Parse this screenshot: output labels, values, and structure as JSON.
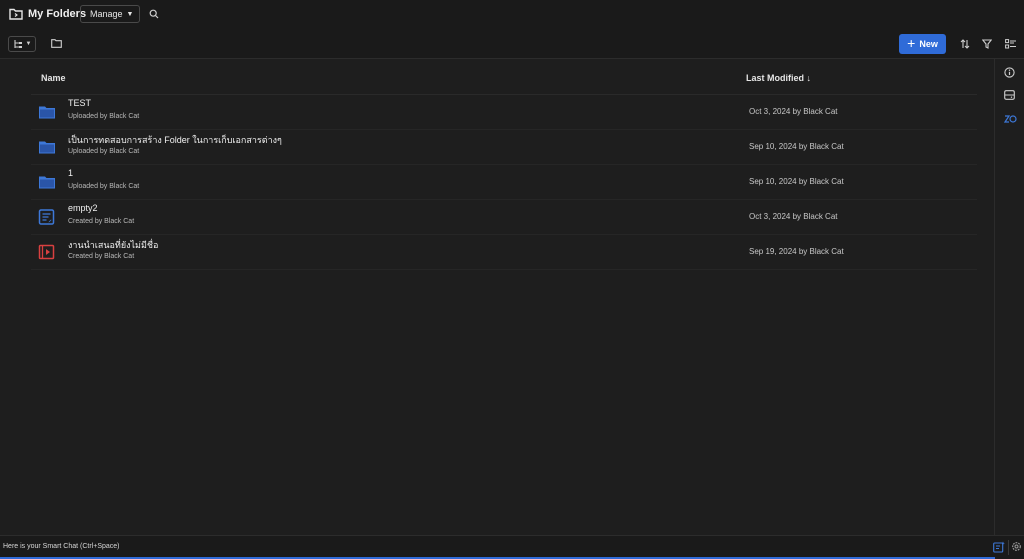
{
  "header": {
    "title": "My Folders",
    "manage_label": "Manage"
  },
  "toolbar": {
    "new_label": "New"
  },
  "columns": {
    "name": "Name",
    "last_modified": "Last Modified ↓"
  },
  "rows": [
    {
      "name": "TEST",
      "sub": "Uploaded by Black Cat",
      "modified": "Oct 3, 2024 by Black Cat",
      "icon": "folder-icon"
    },
    {
      "name": "เป็นการทดสอบการสร้าง Folder ในการเก็บเอกสารต่างๆ",
      "sub": "Uploaded by Black Cat",
      "modified": "Sep 10, 2024 by Black Cat",
      "icon": "folder-icon"
    },
    {
      "name": "1",
      "sub": "Uploaded by Black Cat",
      "modified": "Sep 10, 2024 by Black Cat",
      "icon": "folder-icon"
    },
    {
      "name": "empty2",
      "sub": "Created by Black Cat",
      "modified": "Oct 3, 2024 by Black Cat",
      "icon": "document-icon"
    },
    {
      "name": "งานนำเสนอที่ยังไม่มีชื่อ",
      "sub": "Created by Black Cat",
      "modified": "Sep 19, 2024 by Black Cat",
      "icon": "presentation-icon"
    }
  ],
  "status": {
    "text": "Here is your Smart Chat (Ctrl+Space)"
  },
  "colors": {
    "accent": "#2f6bd8",
    "folder": "#3d78d8",
    "document": "#3d78d8",
    "presentation": "#d84040",
    "background": "#1e1e1e"
  }
}
